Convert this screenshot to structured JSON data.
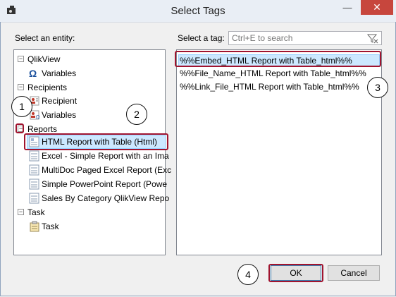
{
  "window": {
    "title": "Select Tags",
    "minimize_glyph": "—",
    "close_glyph": "✕"
  },
  "left": {
    "label": "Select an entity:",
    "tree": [
      {
        "label": "QlikView",
        "icon": "minus-expander",
        "kind": "group"
      },
      {
        "label": "Variables",
        "icon": "omega-icon",
        "kind": "child"
      },
      {
        "label": "Recipients",
        "icon": "minus-expander",
        "kind": "group"
      },
      {
        "label": "Recipient",
        "icon": "recipient-icon",
        "kind": "child"
      },
      {
        "label": "Variables",
        "icon": "variables-icon",
        "kind": "child"
      },
      {
        "label": "Reports",
        "icon": "minus-expander",
        "kind": "group"
      },
      {
        "label": "HTML Report with Table (Html)",
        "icon": "report-icon",
        "kind": "child",
        "selected": true
      },
      {
        "label": "Excel - Simple Report with an Ima",
        "icon": "report-icon",
        "kind": "child"
      },
      {
        "label": "MultiDoc Paged Excel Report (Exc",
        "icon": "report-icon",
        "kind": "child"
      },
      {
        "label": "Simple PowerPoint Report (Powe",
        "icon": "report-icon",
        "kind": "child"
      },
      {
        "label": "Sales By Category QlikView Repo",
        "icon": "report-icon",
        "kind": "child"
      },
      {
        "label": "Task",
        "icon": "minus-expander",
        "kind": "group"
      },
      {
        "label": "Task",
        "icon": "task-icon",
        "kind": "child"
      }
    ]
  },
  "right": {
    "label": "Select a tag:",
    "search_placeholder": "Ctrl+E to search",
    "tags": [
      {
        "label": "%%Embed_HTML Report with Table_html%%",
        "selected": true
      },
      {
        "label": "%%File_Name_HTML Report with Table_html%%"
      },
      {
        "label": "%%Link_File_HTML Report with Table_html%%"
      }
    ]
  },
  "callouts": [
    "1",
    "2",
    "3",
    "4"
  ],
  "buttons": {
    "ok": "OK",
    "cancel": "Cancel"
  },
  "colors": {
    "highlight": "#a0142f",
    "selection": "#cce8ff",
    "close": "#c7463d"
  }
}
